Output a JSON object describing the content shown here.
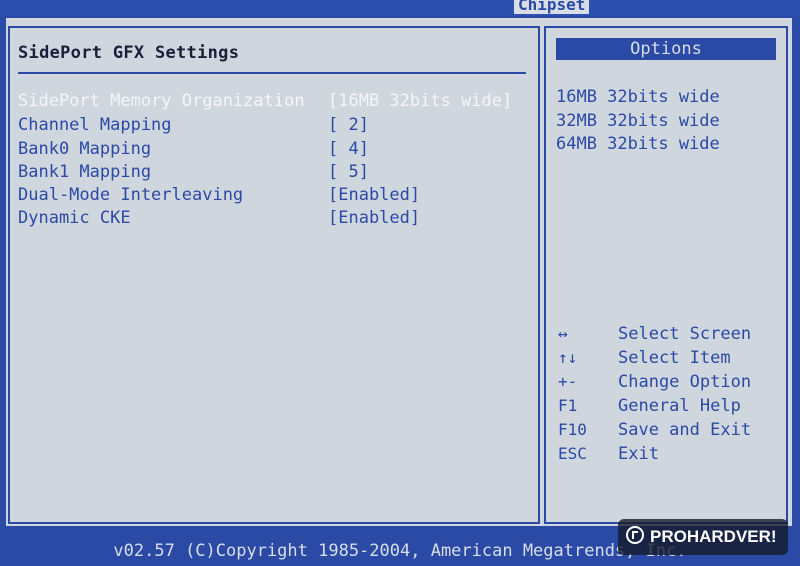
{
  "top_bar": {
    "tab_label": "Chipset"
  },
  "main": {
    "title": "SidePort GFX Settings",
    "settings": [
      {
        "name": "SidePort Memory Organization",
        "value": "[16MB 32bits wide]"
      },
      {
        "name": "Channel Mapping",
        "value": "[ 2]"
      },
      {
        "name": "Bank0 Mapping",
        "value": "[ 4]"
      },
      {
        "name": "Bank1 Mapping",
        "value": "[ 5]"
      },
      {
        "name": "Dual-Mode Interleaving",
        "value": "[Enabled]"
      },
      {
        "name": "Dynamic CKE",
        "value": "[Enabled]"
      }
    ]
  },
  "options_panel": {
    "header": "Options",
    "items": [
      "16MB 32bits wide",
      "32MB 32bits wide",
      "64MB 32bits wide"
    ]
  },
  "help": [
    {
      "key": "↔",
      "desc": "Select Screen"
    },
    {
      "key": "↑↓",
      "desc": "Select Item"
    },
    {
      "key": "+-",
      "desc": "Change Option"
    },
    {
      "key": "F1",
      "desc": "General Help"
    },
    {
      "key": "F10",
      "desc": "Save and Exit"
    },
    {
      "key": "ESC",
      "desc": "Exit"
    }
  ],
  "footer": {
    "text": "v02.57 (C)Copyright 1985-2004, American Megatrends, Inc."
  },
  "watermark": {
    "text": "PROHARDVER!"
  },
  "colors": {
    "background_blue": "#2a4aa6",
    "panel_gray": "#d0d6de",
    "highlight_white": "#f4f6fa"
  }
}
